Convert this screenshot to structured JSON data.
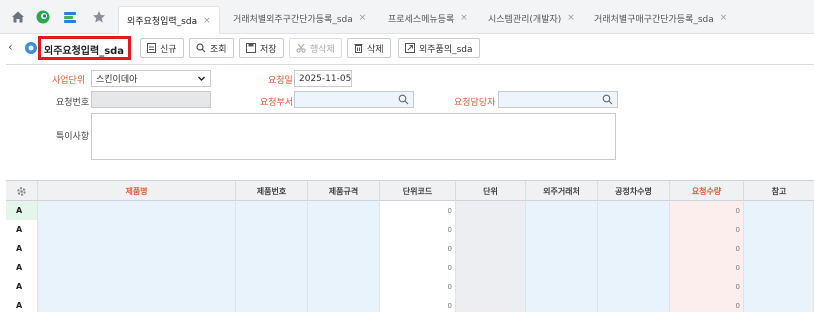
{
  "tabbar": {
    "tabs": [
      {
        "label": "외주요청입력_sda",
        "active": true
      },
      {
        "label": "거래처별외주구간단가등록_sda",
        "active": false
      },
      {
        "label": "프로세스메뉴등록",
        "active": false
      },
      {
        "label": "시스템관리(개발자)",
        "active": false
      },
      {
        "label": "거래처별구매구간단가등록_sda",
        "active": false
      }
    ],
    "close_glyph": "×"
  },
  "toolbar": {
    "page_title": "외주요청입력_sda",
    "buttons": {
      "new": "신규",
      "search": "조회",
      "save": "저장",
      "row_delete": "행삭제",
      "delete": "삭제",
      "outsource_item": "외주품의_sda"
    }
  },
  "form": {
    "business_unit": {
      "label": "사업단위",
      "value": "스킨이데아"
    },
    "request_date": {
      "label": "요청일",
      "value": "2025-11-05"
    },
    "request_no": {
      "label": "요청번호",
      "value": ""
    },
    "request_dept": {
      "label": "요청부서",
      "value": ""
    },
    "requester": {
      "label": "요청담당자",
      "value": ""
    },
    "remarks": {
      "label": "특이사항",
      "value": ""
    }
  },
  "grid": {
    "columns": [
      "제품명",
      "제품번호",
      "제품규격",
      "단위코드",
      "단위",
      "외주거래처",
      "공정차수명",
      "요청수량",
      "참고"
    ],
    "rows": [
      {
        "marker": "A",
        "unit_code": "0",
        "qty": "0"
      },
      {
        "marker": "A",
        "unit_code": "0",
        "qty": "0"
      },
      {
        "marker": "A",
        "unit_code": "0",
        "qty": "0"
      },
      {
        "marker": "A",
        "unit_code": "0",
        "qty": "0"
      },
      {
        "marker": "A",
        "unit_code": "0",
        "qty": "0"
      },
      {
        "marker": "A",
        "unit_code": "0",
        "qty": "0"
      }
    ]
  },
  "colors": {
    "highlight_border": "#e3191e",
    "required_label": "#e35b3a",
    "cell_blue": "#e9f3fc",
    "cell_pink": "#fdeeee"
  }
}
